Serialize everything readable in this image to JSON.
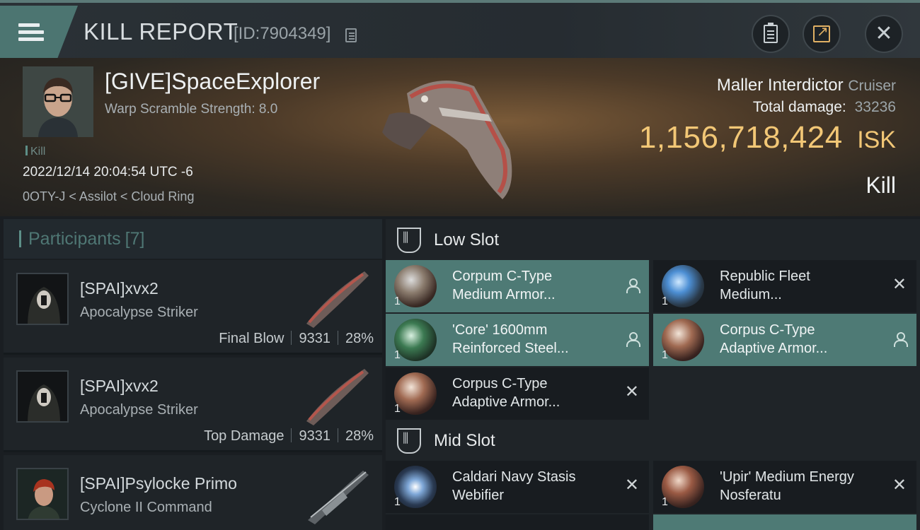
{
  "header": {
    "title": "KILL REPORT",
    "report_id": "[ID:7904349]"
  },
  "victim": {
    "name": "[GIVE]SpaceExplorer",
    "warp_scramble": "Warp Scramble Strength: 8.0",
    "tag": "Kill",
    "datetime": "2022/12/14 20:04:54 UTC -6",
    "location": "0OTY-J < Assilot < Cloud Ring"
  },
  "ship": {
    "name": "Maller Interdictor",
    "class": "Cruiser",
    "total_damage_label": "Total damage:",
    "total_damage_value": "33236",
    "isk_value": "1,156,718,424",
    "isk_unit": "ISK",
    "result": "Kill"
  },
  "participants": {
    "title": "Participants",
    "count": "[7]",
    "rows": [
      {
        "name": "[SPAI]xvx2",
        "ship": "Apocalypse Striker",
        "role": "Final Blow",
        "damage": "9331",
        "percent": "28%"
      },
      {
        "name": "[SPAI]xvx2",
        "ship": "Apocalypse Striker",
        "role": "Top Damage",
        "damage": "9331",
        "percent": "28%"
      },
      {
        "name": "[SPAI]Psylocke Primo",
        "ship": "Cyclone II Command"
      }
    ]
  },
  "fitting": {
    "low_slot_label": "Low Slot",
    "mid_slot_label": "Mid Slot",
    "low": [
      {
        "line1": "Corpum C-Type",
        "line2": "Medium Armor...",
        "qty": "1",
        "status": "person-icon"
      },
      {
        "line1": "Republic Fleet",
        "line2": "Medium...",
        "qty": "1",
        "status": "close-icon"
      },
      {
        "line1": "'Core' 1600mm",
        "line2": "Reinforced Steel...",
        "qty": "1",
        "status": "person-icon"
      },
      {
        "line1": "Corpus C-Type",
        "line2": "Adaptive Armor...",
        "qty": "1",
        "status": "person-icon"
      },
      {
        "line1": "Corpus C-Type",
        "line2": "Adaptive Armor...",
        "qty": "1",
        "status": "close-icon"
      }
    ],
    "mid": [
      {
        "line1": "Caldari Navy Stasis",
        "line2": "Webifier",
        "qty": "1",
        "status": "close-icon"
      },
      {
        "line1": "'Upir' Medium Energy",
        "line2": "Nosferatu",
        "qty": "1",
        "status": "close-icon"
      }
    ]
  },
  "colors": {
    "accent": "#4e7a75",
    "isk": "#f2c776"
  }
}
